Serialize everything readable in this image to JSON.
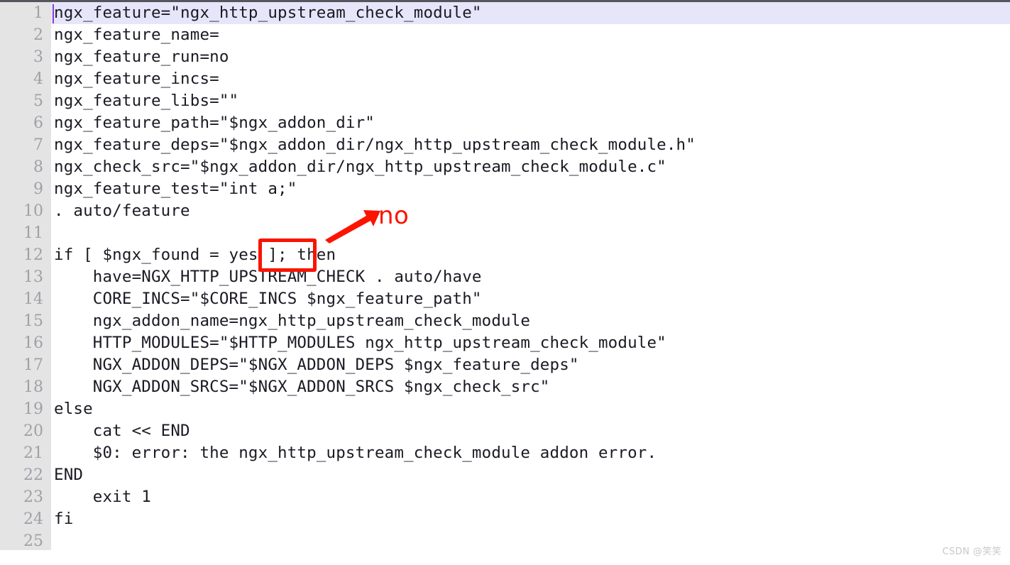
{
  "editor": {
    "active_line": 1,
    "caret_line": 1,
    "caret_column": 1,
    "gutter_color": "#e4e4e4",
    "line_number_color": "#a0a0a8",
    "active_line_color": "#e6e6fa",
    "caret_color": "#8c3fd6",
    "text_color": "#1a1a24",
    "line_numbers": [
      "1",
      "2",
      "3",
      "4",
      "5",
      "6",
      "7",
      "8",
      "9",
      "10",
      "11",
      "12",
      "13",
      "14",
      "15",
      "16",
      "17",
      "18",
      "19",
      "20",
      "21",
      "22",
      "23",
      "24",
      "25"
    ],
    "lines": [
      {
        "n": "1",
        "text": "ngx_feature=\"ngx_http_upstream_check_module\""
      },
      {
        "n": "2",
        "text": "ngx_feature_name="
      },
      {
        "n": "3",
        "text": "ngx_feature_run=no"
      },
      {
        "n": "4",
        "text": "ngx_feature_incs="
      },
      {
        "n": "5",
        "text": "ngx_feature_libs=\"\""
      },
      {
        "n": "6",
        "text": "ngx_feature_path=\"$ngx_addon_dir\""
      },
      {
        "n": "7",
        "text": "ngx_feature_deps=\"$ngx_addon_dir/ngx_http_upstream_check_module.h\""
      },
      {
        "n": "8",
        "text": "ngx_check_src=\"$ngx_addon_dir/ngx_http_upstream_check_module.c\""
      },
      {
        "n": "9",
        "text": "ngx_feature_test=\"int a;\""
      },
      {
        "n": "10",
        "text": ". auto/feature"
      },
      {
        "n": "11",
        "text": ""
      },
      {
        "n": "12",
        "text": "if [ $ngx_found = yes ]; then"
      },
      {
        "n": "13",
        "text": "    have=NGX_HTTP_UPSTREAM_CHECK . auto/have"
      },
      {
        "n": "14",
        "text": "    CORE_INCS=\"$CORE_INCS $ngx_feature_path\""
      },
      {
        "n": "15",
        "text": "    ngx_addon_name=ngx_http_upstream_check_module"
      },
      {
        "n": "16",
        "text": "    HTTP_MODULES=\"$HTTP_MODULES ngx_http_upstream_check_module\""
      },
      {
        "n": "17",
        "text": "    NGX_ADDON_DEPS=\"$NGX_ADDON_DEPS $ngx_feature_deps\""
      },
      {
        "n": "18",
        "text": "    NGX_ADDON_SRCS=\"$NGX_ADDON_SRCS $ngx_check_src\""
      },
      {
        "n": "19",
        "text": "else"
      },
      {
        "n": "20",
        "text": "    cat << END"
      },
      {
        "n": "21",
        "text": "    $0: error: the ngx_http_upstream_check_module addon error."
      },
      {
        "n": "22",
        "text": "END"
      },
      {
        "n": "23",
        "text": "    exit 1"
      },
      {
        "n": "24",
        "text": "fi"
      },
      {
        "n": "25",
        "text": ""
      }
    ]
  },
  "annotations": {
    "color": "#fb1400",
    "highlight_box": {
      "target_text": "yes",
      "target_line": "12"
    },
    "arrow": {
      "from": "highlight-box",
      "to": "no-label"
    },
    "note_label": "no"
  },
  "watermark": {
    "text": "CSDN @笑笑"
  }
}
